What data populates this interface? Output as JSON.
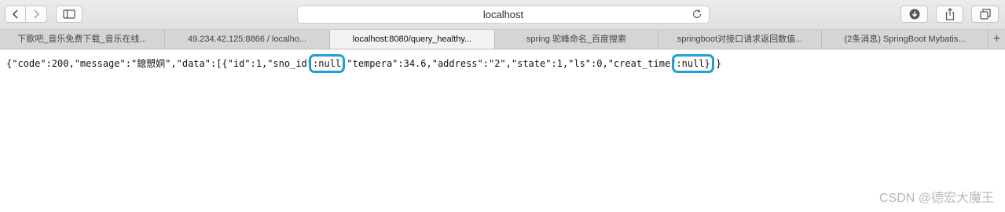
{
  "toolbar": {
    "address": "localhost",
    "icons": [
      "back-icon",
      "forward-icon",
      "sidebar-icon",
      "reload-icon",
      "download-icon",
      "share-icon",
      "tabs-icon"
    ]
  },
  "tabs": [
    {
      "label": "下歌吧_音乐免费下载_音乐在线..."
    },
    {
      "label": "49.234.42.125:8866 / localho..."
    },
    {
      "label": "localhost:8080/query_healthy..."
    },
    {
      "label": "spring 驼峰命名_百度搜索"
    },
    {
      "label": "springboot对接口请求返回数值..."
    },
    {
      "label": "(2条消息) SpringBoot Mybatis..."
    }
  ],
  "json_text": {
    "p1": "{\"code\":200,\"message\":\"鎴愬姛\",\"data\":[{\"id\":1,\"sno_id\"",
    "h1": ":null",
    "p2": ",\"tempera\":34.6,\"address\":\"2\",\"state\":1,\"ls\":0,\"creat_time\"",
    "h2": ":null}",
    "p3": "]}"
  },
  "watermark": "CSDN @德宏大魔王",
  "colors": {
    "highlight": "#1e9fd6"
  }
}
